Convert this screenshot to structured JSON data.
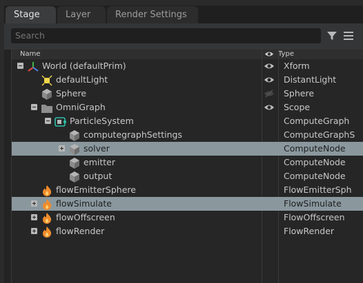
{
  "tabs": [
    {
      "label": "Stage",
      "active": true
    },
    {
      "label": "Layer",
      "active": false
    },
    {
      "label": "Render Settings",
      "active": false
    }
  ],
  "search": {
    "placeholder": "Search"
  },
  "columns": {
    "name": "Name",
    "visibility_icon": "eye-icon",
    "type": "Type"
  },
  "rows": [
    {
      "name": "World (defaultPrim)",
      "type": "Xform",
      "icon": "xform-axes-icon",
      "expander": "minus",
      "visible": true
    },
    {
      "name": "defaultLight",
      "type": "DistantLight",
      "icon": "light-icon",
      "expander": "none",
      "visible": true
    },
    {
      "name": "Sphere",
      "type": "Sphere",
      "icon": "cube-icon",
      "expander": "none",
      "visible": false
    },
    {
      "name": "OmniGraph",
      "type": "Scope",
      "icon": "folder-icon",
      "expander": "minus",
      "visible": true
    },
    {
      "name": "ParticleSystem",
      "type": "ComputeGraph",
      "icon": "compute-graph-icon",
      "expander": "minus",
      "visible": null
    },
    {
      "name": "computegraphSettings",
      "type": "ComputeGraphS",
      "icon": "cube-icon",
      "expander": "none",
      "visible": null
    },
    {
      "name": "solver",
      "type": "ComputeNode",
      "icon": "cube-icon",
      "expander": "plus",
      "visible": null,
      "selected": true
    },
    {
      "name": "emitter",
      "type": "ComputeNode",
      "icon": "cube-icon",
      "expander": "none",
      "visible": null
    },
    {
      "name": "output",
      "type": "ComputeNode",
      "icon": "cube-icon",
      "expander": "none",
      "visible": null
    },
    {
      "name": "flowEmitterSphere",
      "type": "FlowEmitterSph",
      "icon": "flame-icon",
      "expander": "none",
      "visible": null
    },
    {
      "name": "flowSimulate",
      "type": "FlowSimulate",
      "icon": "flame-icon",
      "expander": "plus",
      "visible": null,
      "selected": true
    },
    {
      "name": "flowOffscreen",
      "type": "FlowOffscreen",
      "icon": "flame-icon",
      "expander": "plus",
      "visible": null
    },
    {
      "name": "flowRender",
      "type": "FlowRender",
      "icon": "flame-icon",
      "expander": "plus",
      "visible": null
    }
  ]
}
